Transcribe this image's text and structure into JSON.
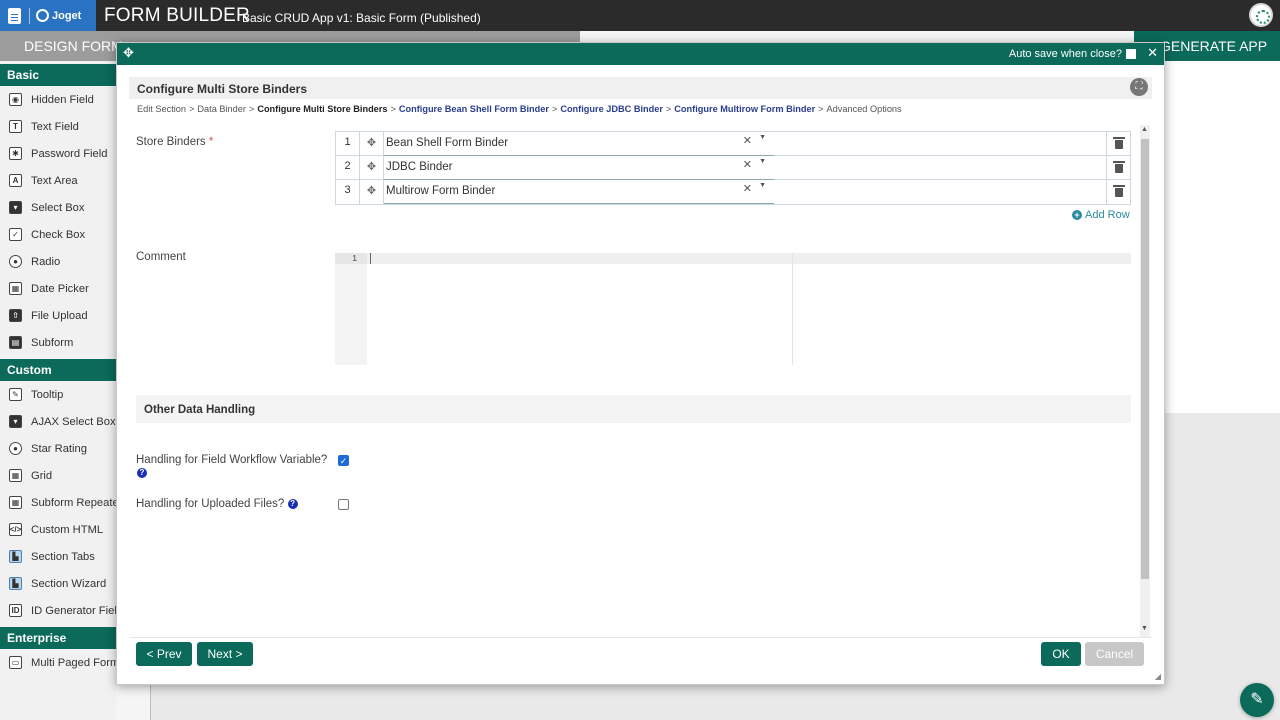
{
  "app": {
    "logo_text": "Joget",
    "title": "FORM BUILDER",
    "subtitle": "Basic CRUD App v1: Basic Form (Published)"
  },
  "tabs": {
    "design": "DESIGN FORM",
    "generate": "GENERATE APP"
  },
  "palette": {
    "sections": [
      {
        "title": "Basic",
        "items": [
          {
            "label": "Hidden Field",
            "icon": "eye-slash-icon",
            "glyph": "◉"
          },
          {
            "label": "Text Field",
            "icon": "text-field-icon",
            "glyph": "T"
          },
          {
            "label": "Password Field",
            "icon": "asterisk-icon",
            "glyph": "✱"
          },
          {
            "label": "Text Area",
            "icon": "text-area-icon",
            "glyph": "A"
          },
          {
            "label": "Select Box",
            "icon": "select-box-icon",
            "glyph": "▾"
          },
          {
            "label": "Check Box",
            "icon": "checkbox-icon",
            "glyph": "✓"
          },
          {
            "label": "Radio",
            "icon": "radio-icon",
            "glyph": "●"
          },
          {
            "label": "Date Picker",
            "icon": "calendar-icon",
            "glyph": "▦"
          },
          {
            "label": "File Upload",
            "icon": "upload-icon",
            "glyph": "⇧"
          },
          {
            "label": "Subform",
            "icon": "subform-icon",
            "glyph": "▤"
          }
        ]
      },
      {
        "title": "Custom",
        "items": [
          {
            "label": "Tooltip",
            "icon": "edit-icon",
            "glyph": "✎"
          },
          {
            "label": "AJAX Select Box",
            "icon": "select-box-icon",
            "glyph": "▾"
          },
          {
            "label": "Star Rating",
            "icon": "radio-icon",
            "glyph": "●"
          },
          {
            "label": "Grid",
            "icon": "grid-icon",
            "glyph": "▦"
          },
          {
            "label": "Subform Repeater",
            "icon": "grid-icon",
            "glyph": "▦"
          },
          {
            "label": "Custom HTML",
            "icon": "code-icon",
            "glyph": "</>"
          },
          {
            "label": "Section Tabs",
            "icon": "section-tabs-icon",
            "glyph": "▙"
          },
          {
            "label": "Section Wizard",
            "icon": "section-wizard-icon",
            "glyph": "▙"
          },
          {
            "label": "ID Generator Field",
            "icon": "id-icon",
            "glyph": "ID"
          }
        ]
      },
      {
        "title": "Enterprise",
        "items": [
          {
            "label": "Multi Paged Form",
            "icon": "multi-page-icon",
            "glyph": "▭"
          }
        ]
      }
    ]
  },
  "modal": {
    "autosave_label": "Auto save when close?",
    "close_glyph": "✕",
    "move_glyph": "✥",
    "section_title": "Configure Multi Store Binders",
    "breadcrumbs": [
      {
        "label": "Edit Section",
        "style": "plain"
      },
      {
        "label": "Data Binder",
        "style": "plain"
      },
      {
        "label": "Configure Multi Store Binders",
        "style": "current"
      },
      {
        "label": "Configure Bean Shell Form Binder",
        "style": "link"
      },
      {
        "label": "Configure JDBC Binder",
        "style": "link"
      },
      {
        "label": "Configure Multirow Form Binder",
        "style": "link"
      },
      {
        "label": "Advanced Options",
        "style": "plain"
      }
    ],
    "breadcrumb_sep": ">",
    "store_binders": {
      "label": "Store Binders",
      "required_mark": "*",
      "rows": [
        {
          "num": "1",
          "value": "Bean Shell Form Binder"
        },
        {
          "num": "2",
          "value": "JDBC Binder"
        },
        {
          "num": "3",
          "value": "Multirow Form Binder"
        }
      ],
      "add_row_label": "Add Row"
    },
    "comment": {
      "label": "Comment",
      "line_number": "1"
    },
    "other_data": {
      "title": "Other Data Handling",
      "workflow_var_label": "Handling for Field Workflow Variable?",
      "workflow_var_checked": true,
      "uploaded_files_label": "Handling for Uploaded Files?",
      "uploaded_files_checked": false,
      "help_glyph": "?"
    },
    "buttons": {
      "prev": "< Prev",
      "next": "Next >",
      "ok": "OK",
      "cancel": "Cancel"
    }
  },
  "colors": {
    "primary": "#0b6a5a",
    "joget_blue": "#2a73c3",
    "link": "#2a3d8f",
    "checkbox": "#1e6bd8"
  }
}
